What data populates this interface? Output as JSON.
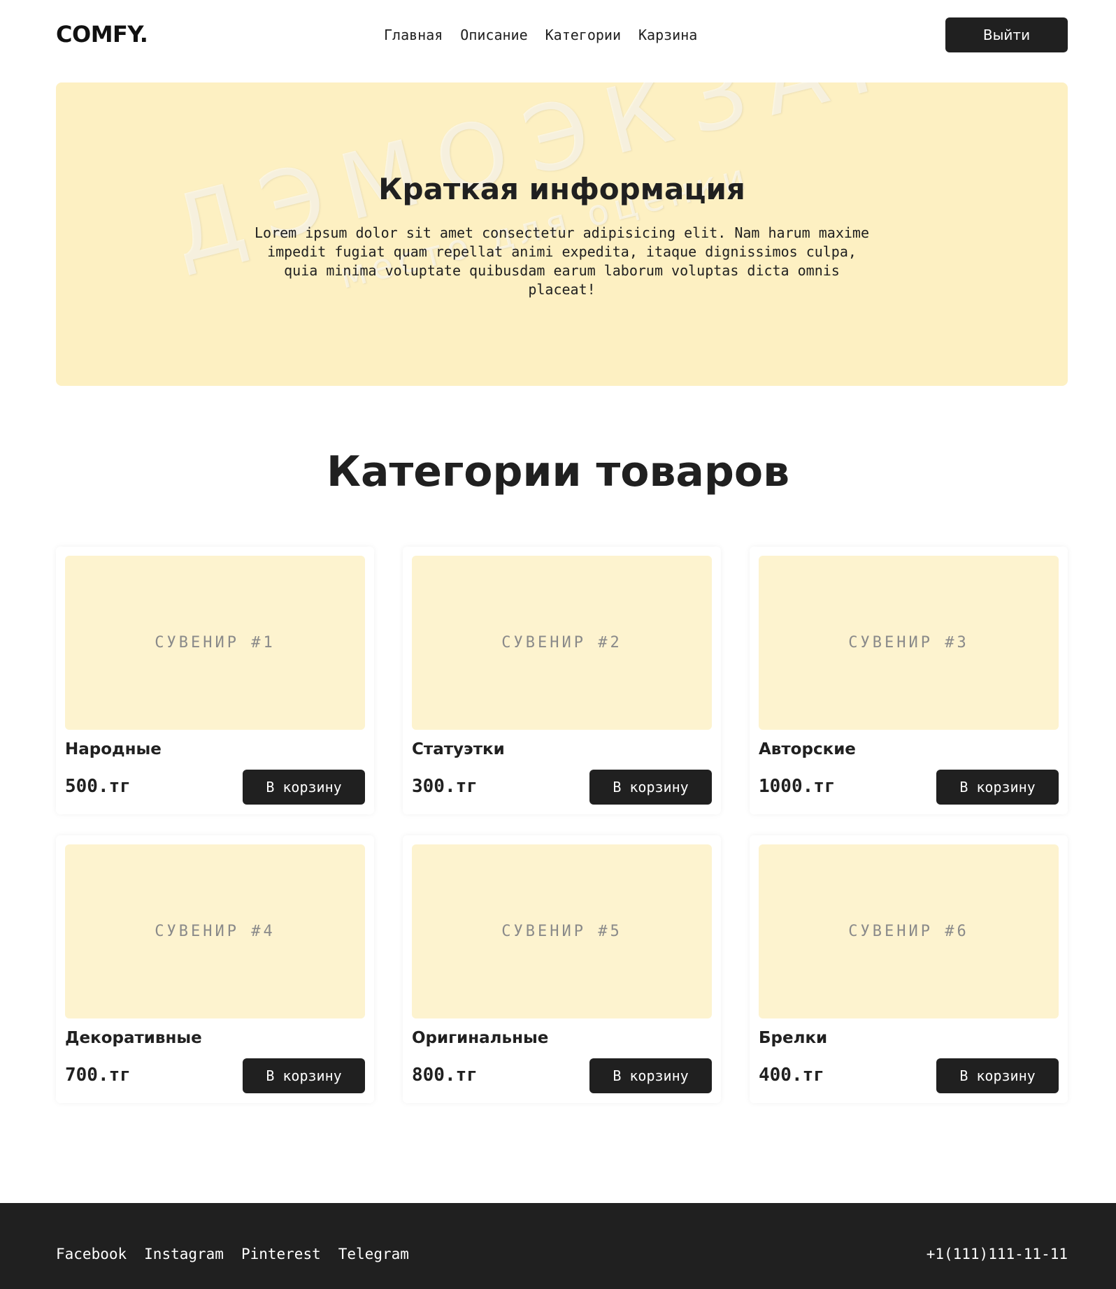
{
  "header": {
    "logo": "COMFY.",
    "nav": [
      {
        "label": "Главная"
      },
      {
        "label": "Описание"
      },
      {
        "label": "Категории"
      },
      {
        "label": "Карзина"
      }
    ],
    "logout_label": "Выйти"
  },
  "hero": {
    "title": "Краткая информация",
    "text": "Lorem ipsum dolor sit amet consectetur adipisicing elit. Nam harum maxime impedit fugiat quam repellat animi expedita, itaque dignissimos culpa, quia minima voluptate quibusdam earum laborum voluptas dicta omnis placeat!",
    "watermark": "ДЭМОЭКЗАМЕН",
    "watermark_sub": "место для оценки"
  },
  "section": {
    "title": "Категории товаров"
  },
  "products": [
    {
      "image_label": "СУВЕНИР #1",
      "name": "Народные",
      "price": "500.тг",
      "button": "В корзину"
    },
    {
      "image_label": "СУВЕНИР #2",
      "name": "Статуэтки",
      "price": "300.тг",
      "button": "В корзину"
    },
    {
      "image_label": "СУВЕНИР #3",
      "name": "Авторские",
      "price": "1000.тг",
      "button": "В корзину"
    },
    {
      "image_label": "СУВЕНИР #4",
      "name": "Декоративные",
      "price": "700.тг",
      "button": "В корзину"
    },
    {
      "image_label": "СУВЕНИР #5",
      "name": "Оригинальные",
      "price": "800.тг",
      "button": "В корзину"
    },
    {
      "image_label": "СУВЕНИР #6",
      "name": "Брелки",
      "price": "400.тг",
      "button": "В корзину"
    }
  ],
  "footer": {
    "links": [
      {
        "label": "Facebook"
      },
      {
        "label": "Instagram"
      },
      {
        "label": "Pinterest"
      },
      {
        "label": "Telegram"
      }
    ],
    "phone": "+1(111)111-11-11"
  },
  "colors": {
    "dark": "#202020",
    "hero_bg": "#fdf0c2",
    "card_image_bg": "#fdf3cf",
    "text_on_dark": "#ffffff"
  }
}
